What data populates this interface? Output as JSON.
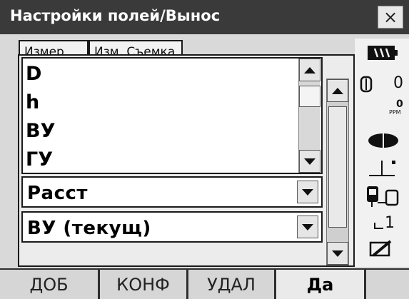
{
  "window": {
    "title": "Настройки полей/Вынос",
    "close_glyph": "×"
  },
  "tabs": [
    {
      "label": "Измер"
    },
    {
      "label": "Изм. Съемка"
    }
  ],
  "list": {
    "items": [
      "D",
      "h",
      "ВУ",
      "ГУ"
    ]
  },
  "fields": {
    "dropdown1_value": "Расст",
    "dropdown2_value": "ВУ (текущ)"
  },
  "status": {
    "prism_constant": "0",
    "ppm_value": "0",
    "ppm_unit": "PPM",
    "page_number": "1"
  },
  "softkeys": [
    {
      "label": "ДОБ"
    },
    {
      "label": "КОНФ"
    },
    {
      "label": "УДАЛ"
    },
    {
      "label": "Да"
    },
    {
      "label": ""
    }
  ],
  "colors": {
    "titlebar": "#3a3a3a",
    "background": "#d9d9d9",
    "softkey_bar": "#2e2e2e"
  }
}
